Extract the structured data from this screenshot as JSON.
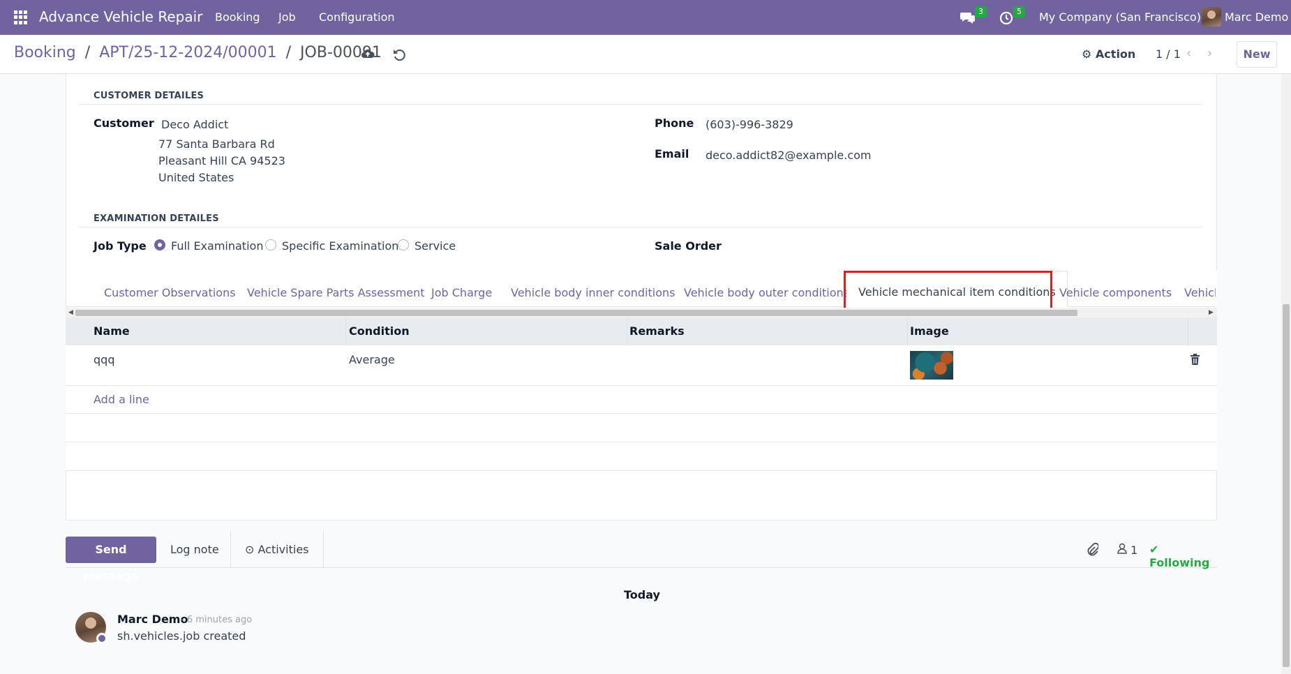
{
  "navbar": {
    "brand": "Advance Vehicle Repair",
    "menu": [
      "Booking",
      "Job",
      "Configuration"
    ],
    "messages_count": "3",
    "activities_count": "5",
    "company": "My Company (San Francisco)",
    "user": "Marc Demo"
  },
  "breadcrumb": {
    "root": "Booking",
    "parent": "APT/25-12-2024/00001",
    "current": "JOB-00091",
    "sep": "/"
  },
  "controls": {
    "action_label": "Action",
    "pager": "1 / 1",
    "new_label": "New"
  },
  "customer_section": {
    "title": "CUSTOMER DETAILES",
    "customer_label": "Customer",
    "customer_name": "Deco Addict",
    "address_line1": "77 Santa Barbara Rd",
    "address_line2": "Pleasant Hill CA 94523",
    "address_line3": "United States",
    "phone_label": "Phone",
    "phone": "(603)-996-3829",
    "email_label": "Email",
    "email": "deco.addict82@example.com"
  },
  "examination_section": {
    "title": "EXAMINATION DETAILES",
    "job_type_label": "Job Type",
    "job_type_options": [
      "Full Examination",
      "Specific Examination",
      "Service"
    ],
    "job_type_selected": "Full Examination",
    "sale_order_label": "Sale Order"
  },
  "tabs": [
    "Customer Observations",
    "Vehicle Spare Parts Assessment",
    "Job Charge",
    "Vehicle body inner conditions",
    "Vehicle body outer conditions",
    "Vehicle mechanical item conditions",
    "Vehicle components",
    "Vehicl"
  ],
  "active_tab": "Vehicle mechanical item conditions",
  "table": {
    "headers": [
      "Name",
      "Condition",
      "Remarks",
      "Image"
    ],
    "rows": [
      {
        "name": "qqq",
        "condition": "Average",
        "remarks": ""
      }
    ],
    "add_line": "Add a line"
  },
  "chatter": {
    "send_message": "Send message",
    "log_note": "Log note",
    "activities": "Activities",
    "followers_count": "1",
    "following": "Following",
    "date_separator": "Today",
    "message": {
      "author": "Marc Demo",
      "time": "- 6 minutes ago",
      "body": "sh.vehicles.job created"
    }
  },
  "colors": {
    "brand": "#71639e",
    "badge": "#28a745",
    "following": "#28a745",
    "highlight": "#e11d1d"
  },
  "icons": [
    "apps-grid-icon",
    "chat-icon",
    "clock-icon",
    "cloud-upload-icon",
    "undo-icon",
    "gear-icon",
    "chevron-left-icon",
    "chevron-right-icon",
    "trash-icon",
    "paperclip-icon",
    "user-icon",
    "check-icon"
  ]
}
